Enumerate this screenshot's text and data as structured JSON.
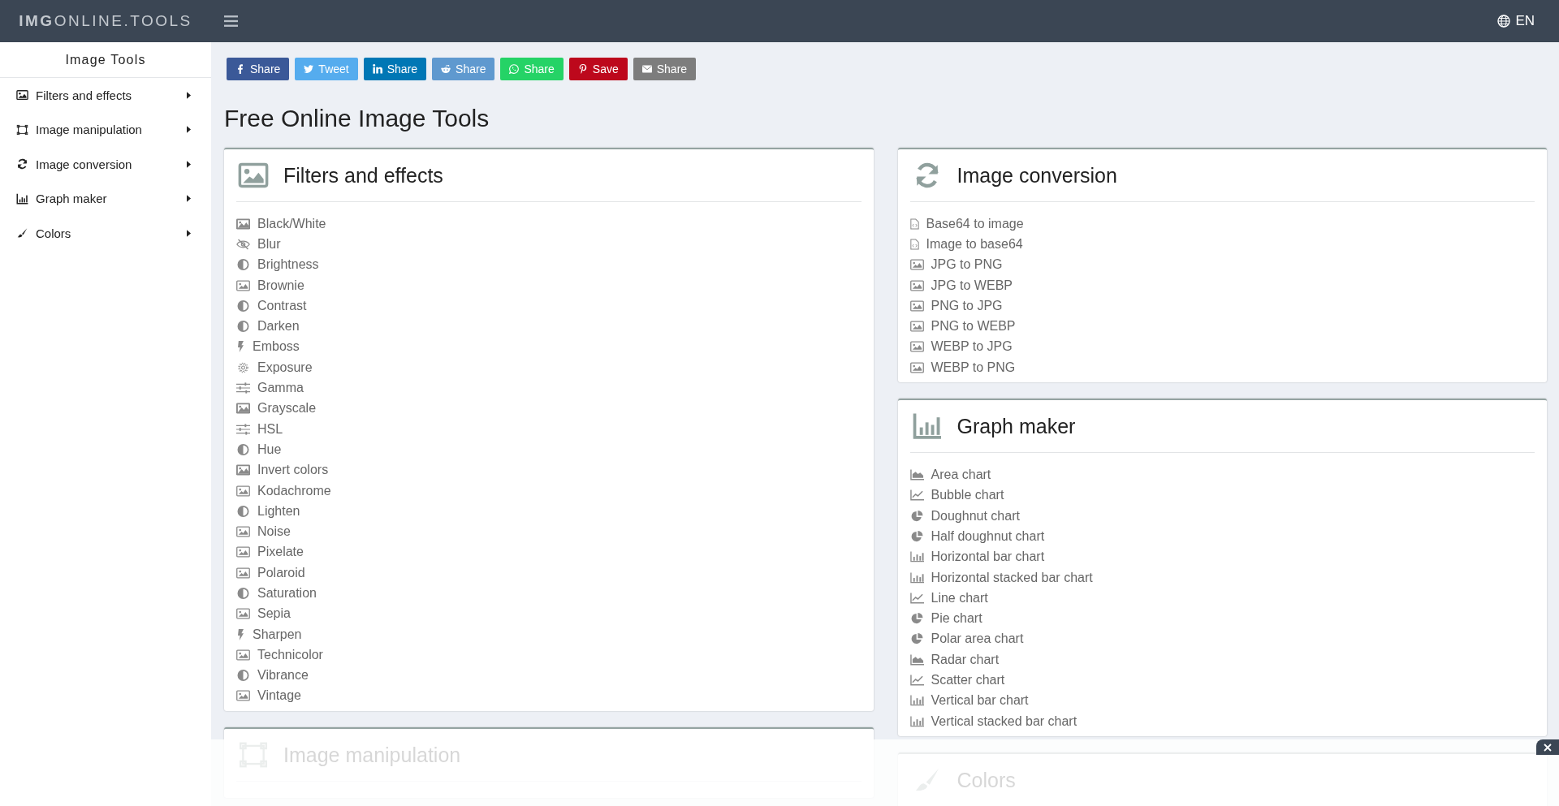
{
  "header": {
    "logo": "**IMG**ONLINE.TOOLS",
    "language": "EN"
  },
  "sidebar": {
    "title": "Image Tools",
    "items": [
      {
        "label": "Filters and effects",
        "kind": "filters"
      },
      {
        "label": "Image manipulation",
        "kind": "manipulation"
      },
      {
        "label": "Image conversion",
        "kind": "conversion"
      },
      {
        "label": "Graph maker",
        "kind": "graph"
      },
      {
        "label": "Colors",
        "kind": "colors"
      }
    ]
  },
  "share_buttons": [
    {
      "label": "Share",
      "kind": "facebook"
    },
    {
      "label": "Tweet",
      "kind": "twitter"
    },
    {
      "label": "Share",
      "kind": "linkedin"
    },
    {
      "label": "Share",
      "kind": "reddit"
    },
    {
      "label": "Share",
      "kind": "whatsapp"
    },
    {
      "label": "Save",
      "kind": "pinterest"
    },
    {
      "label": "Share",
      "kind": "email"
    }
  ],
  "page_title": "Free Online Image Tools",
  "columns": [
    [
      {
        "title": "Filters and effects",
        "kind": "filters",
        "items": [
          {
            "label": "Black/White",
            "kind": "photo"
          },
          {
            "label": "Blur",
            "kind": "eye-slash"
          },
          {
            "label": "Brightness",
            "kind": "contrast"
          },
          {
            "label": "Brownie",
            "kind": "image"
          },
          {
            "label": "Contrast",
            "kind": "contrast"
          },
          {
            "label": "Darken",
            "kind": "contrast"
          },
          {
            "label": "Emboss",
            "kind": "bolt"
          },
          {
            "label": "Exposure",
            "kind": "gear"
          },
          {
            "label": "Gamma",
            "kind": "sliders"
          },
          {
            "label": "Grayscale",
            "kind": "photo"
          },
          {
            "label": "HSL",
            "kind": "sliders"
          },
          {
            "label": "Hue",
            "kind": "contrast"
          },
          {
            "label": "Invert colors",
            "kind": "photo"
          },
          {
            "label": "Kodachrome",
            "kind": "image"
          },
          {
            "label": "Lighten",
            "kind": "contrast"
          },
          {
            "label": "Noise",
            "kind": "image"
          },
          {
            "label": "Pixelate",
            "kind": "image"
          },
          {
            "label": "Polaroid",
            "kind": "image"
          },
          {
            "label": "Saturation",
            "kind": "contrast"
          },
          {
            "label": "Sepia",
            "kind": "image"
          },
          {
            "label": "Sharpen",
            "kind": "bolt"
          },
          {
            "label": "Technicolor",
            "kind": "image"
          },
          {
            "label": "Vibrance",
            "kind": "contrast"
          },
          {
            "label": "Vintage",
            "kind": "image"
          }
        ]
      },
      {
        "title": "Image manipulation",
        "kind": "manipulation"
      }
    ],
    [
      {
        "title": "Image conversion",
        "kind": "conversion",
        "items": [
          {
            "label": "Base64 to image",
            "kind": "file-code"
          },
          {
            "label": "Image to base64",
            "kind": "file-code"
          },
          {
            "label": "JPG to PNG",
            "kind": "image"
          },
          {
            "label": "JPG to WEBP",
            "kind": "image"
          },
          {
            "label": "PNG to JPG",
            "kind": "image"
          },
          {
            "label": "PNG to WEBP",
            "kind": "image"
          },
          {
            "label": "WEBP to JPG",
            "kind": "image"
          },
          {
            "label": "WEBP to PNG",
            "kind": "image"
          }
        ]
      },
      {
        "title": "Graph maker",
        "kind": "graph",
        "items": [
          {
            "label": "Area chart",
            "kind": "area"
          },
          {
            "label": "Bubble chart",
            "kind": "line"
          },
          {
            "label": "Doughnut chart",
            "kind": "pie"
          },
          {
            "label": "Half doughnut chart",
            "kind": "pie"
          },
          {
            "label": "Horizontal bar chart",
            "kind": "bar"
          },
          {
            "label": "Horizontal stacked bar chart",
            "kind": "bar"
          },
          {
            "label": "Line chart",
            "kind": "line"
          },
          {
            "label": "Pie chart",
            "kind": "pie"
          },
          {
            "label": "Polar area chart",
            "kind": "pie"
          },
          {
            "label": "Radar chart",
            "kind": "area"
          },
          {
            "label": "Scatter chart",
            "kind": "line"
          },
          {
            "label": "Vertical bar chart",
            "kind": "bar"
          },
          {
            "label": "Vertical stacked bar chart",
            "kind": "bar"
          }
        ]
      },
      {
        "title": "Colors",
        "kind": "colors"
      }
    ]
  ],
  "bottom_overlay": {
    "visible": true
  }
}
